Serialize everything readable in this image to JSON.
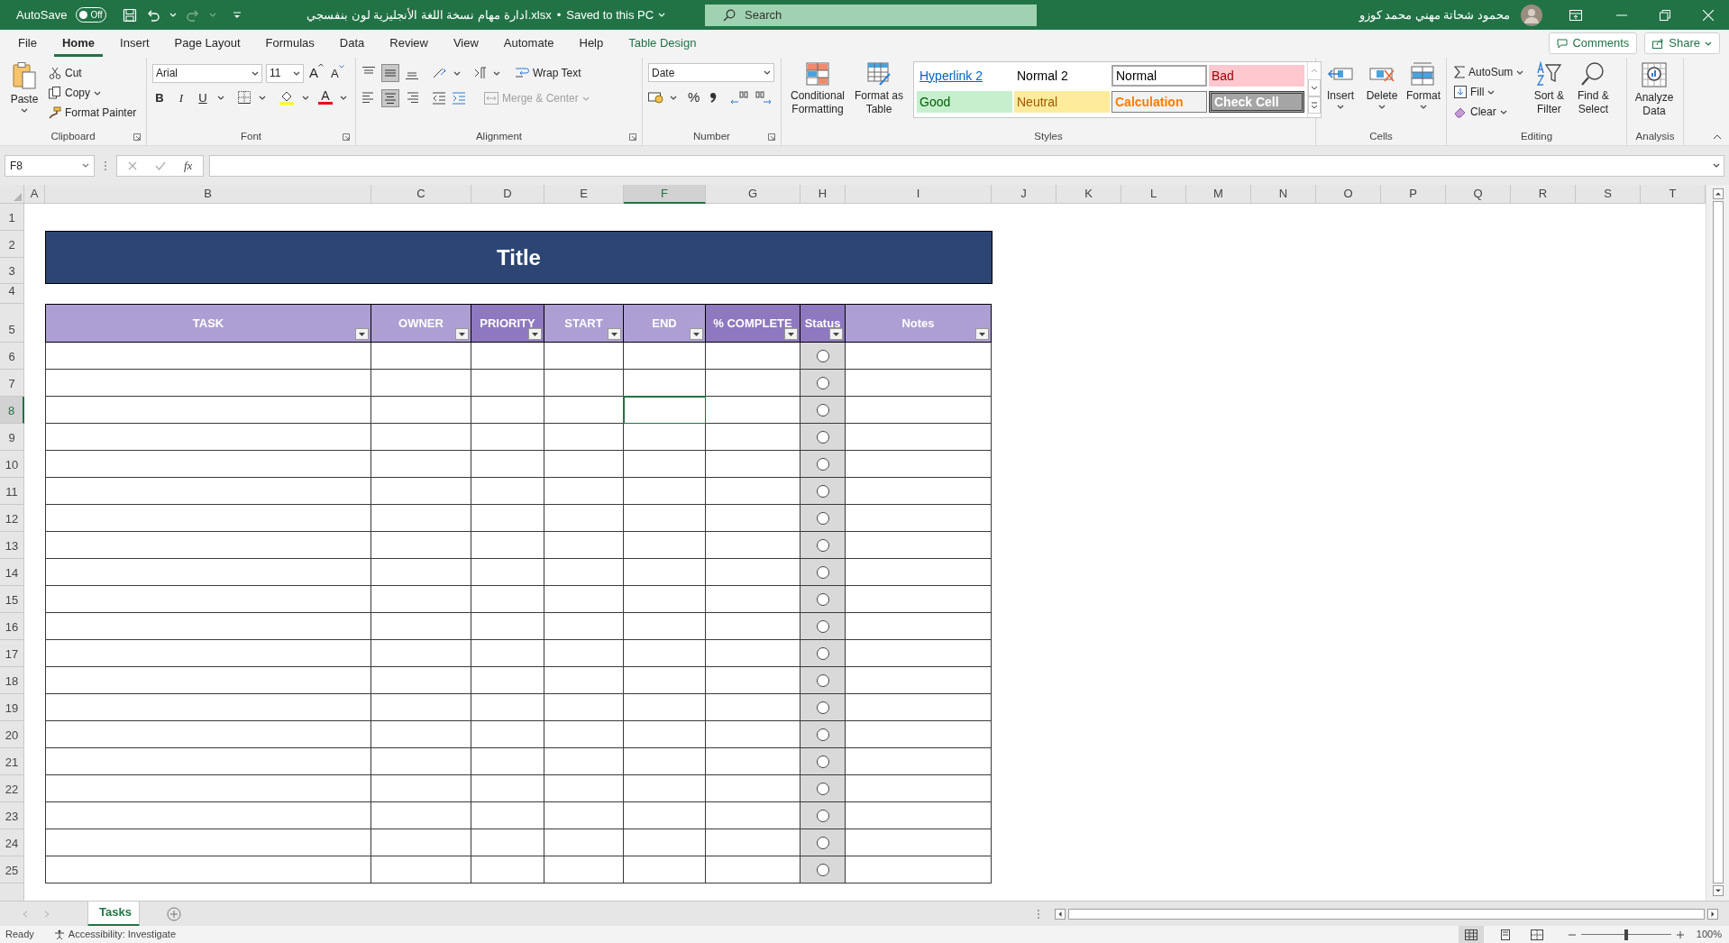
{
  "title_bar": {
    "autosave": "AutoSave",
    "autosave_on": false,
    "toggle_label": "Off",
    "file_name": "ادارة مهام نسخة اللغة الأنجليزية لون بنفسجي.xlsx",
    "separator": "•",
    "save_status": "Saved to this PC",
    "search_placeholder": "Search",
    "user_name": "محمود شحاتة مهني محمد كوزو"
  },
  "menu_tabs": [
    {
      "label": "File",
      "selected": false,
      "kind": "standard"
    },
    {
      "label": "Home",
      "selected": true,
      "kind": "standard"
    },
    {
      "label": "Insert",
      "selected": false,
      "kind": "standard"
    },
    {
      "label": "Page Layout",
      "selected": false,
      "kind": "standard"
    },
    {
      "label": "Formulas",
      "selected": false,
      "kind": "standard"
    },
    {
      "label": "Data",
      "selected": false,
      "kind": "standard"
    },
    {
      "label": "Review",
      "selected": false,
      "kind": "standard"
    },
    {
      "label": "View",
      "selected": false,
      "kind": "standard"
    },
    {
      "label": "Automate",
      "selected": false,
      "kind": "standard"
    },
    {
      "label": "Help",
      "selected": false,
      "kind": "standard"
    },
    {
      "label": "Table Design",
      "selected": false,
      "kind": "contextual"
    }
  ],
  "share_buttons": [
    "Comments",
    "Share"
  ],
  "ribbon": {
    "clipboard": {
      "label": "Clipboard",
      "paste": "Paste",
      "cut": "Cut",
      "copy": "Copy",
      "format_painter": "Format Painter"
    },
    "font": {
      "label": "Font",
      "font_name": "Arial",
      "font_size": "11",
      "grow_font": "A",
      "shrink_font": "A",
      "bold": "B",
      "italic": "I",
      "underline": "U",
      "font_color": "A"
    },
    "alignment": {
      "label": "Alignment",
      "wrap_text": "Wrap Text",
      "merge_center": "Merge & Center",
      "merge_center_disabled": true
    },
    "number": {
      "label": "Number",
      "format": "Date",
      "percent": "%"
    },
    "styles": {
      "label": "Styles",
      "conditional_formatting": "Conditional Formatting",
      "format_as_table": "Format as Table",
      "cell_styles": [
        {
          "label": "Hyperlink 2",
          "kind": "hyperlink"
        },
        {
          "label": "Normal 2",
          "kind": "plain"
        },
        {
          "label": "Normal",
          "kind": "boxed"
        },
        {
          "label": "Bad",
          "kind": "bad"
        },
        {
          "label": "Good",
          "kind": "good"
        },
        {
          "label": "Neutral",
          "kind": "neutral"
        },
        {
          "label": "Calculation",
          "kind": "calculation"
        },
        {
          "label": "Check Cell",
          "kind": "check"
        }
      ]
    },
    "cells": {
      "label": "Cells",
      "buttons": [
        "Insert",
        "Delete",
        "Format"
      ]
    },
    "editing": {
      "label": "Editing",
      "autosum": "AutoSum",
      "fill": "Fill",
      "clear": "Clear",
      "sort_filter": "Sort & Filter",
      "find_select": "Find & Select"
    },
    "analysis": {
      "label": "Analysis",
      "analyze_data": "Analyze Data"
    }
  },
  "formula_bar": {
    "name_box": "F8",
    "function_label": "fx"
  },
  "sheet": {
    "column_headers": [
      {
        "label": "A",
        "selected": false
      },
      {
        "label": "B",
        "selected": false
      },
      {
        "label": "C",
        "selected": false
      },
      {
        "label": "D",
        "selected": false
      },
      {
        "label": "E",
        "selected": false
      },
      {
        "label": "F",
        "selected": true
      },
      {
        "label": "G",
        "selected": false
      },
      {
        "label": "H",
        "selected": false
      },
      {
        "label": "I",
        "selected": false
      },
      {
        "label": "J",
        "selected": false
      },
      {
        "label": "K",
        "selected": false
      },
      {
        "label": "L",
        "selected": false
      },
      {
        "label": "M",
        "selected": false
      },
      {
        "label": "N",
        "selected": false
      },
      {
        "label": "O",
        "selected": false
      },
      {
        "label": "P",
        "selected": false
      },
      {
        "label": "Q",
        "selected": false
      },
      {
        "label": "R",
        "selected": false
      },
      {
        "label": "S",
        "selected": false
      },
      {
        "label": "T",
        "selected": false
      }
    ],
    "row_headers": [
      {
        "label": "1",
        "selected": false
      },
      {
        "label": "2",
        "selected": false
      },
      {
        "label": "3",
        "selected": false
      },
      {
        "label": "4",
        "selected": false
      },
      {
        "label": "5",
        "selected": false
      },
      {
        "label": "6",
        "selected": false
      },
      {
        "label": "7",
        "selected": false
      },
      {
        "label": "8",
        "selected": true
      },
      {
        "label": "9",
        "selected": false
      },
      {
        "label": "10",
        "selected": false
      },
      {
        "label": "11",
        "selected": false
      },
      {
        "label": "12",
        "selected": false
      },
      {
        "label": "13",
        "selected": false
      },
      {
        "label": "14",
        "selected": false
      },
      {
        "label": "15",
        "selected": false
      },
      {
        "label": "16",
        "selected": false
      },
      {
        "label": "17",
        "selected": false
      },
      {
        "label": "18",
        "selected": false
      },
      {
        "label": "19",
        "selected": false
      },
      {
        "label": "20",
        "selected": false
      },
      {
        "label": "21",
        "selected": false
      },
      {
        "label": "22",
        "selected": false
      },
      {
        "label": "23",
        "selected": false
      },
      {
        "label": "24",
        "selected": false
      },
      {
        "label": "25",
        "selected": false
      }
    ],
    "title": "Title",
    "table_columns": [
      {
        "label": "TASK",
        "color": "#ad9fd3",
        "kind": "text"
      },
      {
        "label": "OWNER",
        "color": "#ad9fd3",
        "kind": "text"
      },
      {
        "label": "PRIORITY",
        "color": "#8e78c0",
        "kind": "text"
      },
      {
        "label": "START",
        "color": "#ad9fd3",
        "kind": "text"
      },
      {
        "label": "END",
        "color": "#ad9fd3",
        "kind": "text"
      },
      {
        "label": "% COMPLETE",
        "color": "#8e78c0",
        "kind": "text"
      },
      {
        "label": "Status",
        "color": "#8e78c0",
        "kind": "status"
      },
      {
        "label": "Notes",
        "color": "#ad9fd3",
        "kind": "text"
      }
    ],
    "task_rows": [
      {
        "status_checked": false
      },
      {
        "status_checked": false
      },
      {
        "status_checked": false
      },
      {
        "status_checked": false
      },
      {
        "status_checked": false
      },
      {
        "status_checked": false
      },
      {
        "status_checked": false
      },
      {
        "status_checked": false
      },
      {
        "status_checked": false
      },
      {
        "status_checked": false
      },
      {
        "status_checked": false
      },
      {
        "status_checked": false
      },
      {
        "status_checked": false
      },
      {
        "status_checked": false
      },
      {
        "status_checked": false
      },
      {
        "status_checked": false
      },
      {
        "status_checked": false
      },
      {
        "status_checked": false
      },
      {
        "status_checked": false
      },
      {
        "status_checked": false
      }
    ]
  },
  "sheet_tabs": [
    {
      "label": "Tasks",
      "selected": true
    }
  ],
  "status_bar": {
    "ready": "Ready",
    "accessibility": "Accessibility: Investigate",
    "zoom": "100%",
    "zoom_slider": {
      "level": 0.5
    }
  }
}
